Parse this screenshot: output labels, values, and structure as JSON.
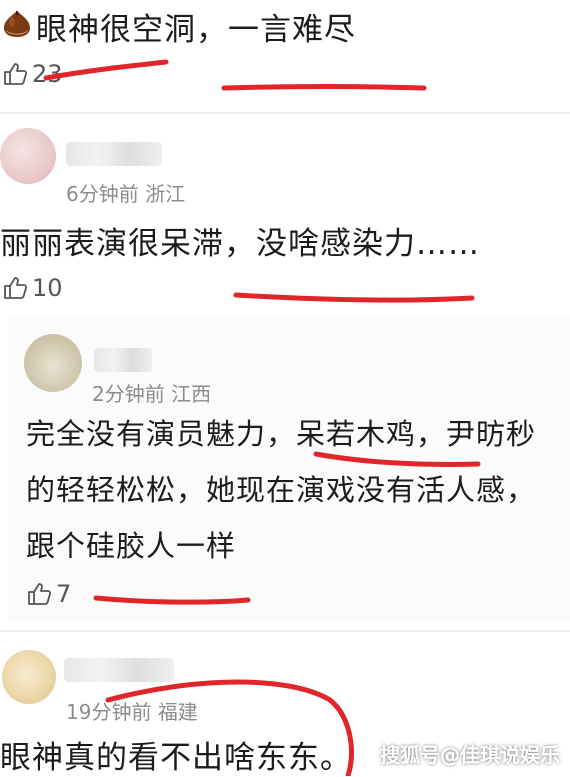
{
  "comments": [
    {
      "text": "眼神很空洞，一言难尽",
      "likes": "23"
    },
    {
      "meta": "6分钟前 浙江",
      "text": "丽丽表演很呆滞，没啥感染力……",
      "likes": "10"
    },
    {
      "meta": "2分钟前 江西",
      "lines": [
        "完全没有演员魅力，呆若木鸡，尹昉秒",
        "的轻轻松松，她现在演戏没有活人感，",
        "跟个硅胶人一样"
      ],
      "likes": "7"
    },
    {
      "meta": "19分钟前 福建",
      "text": "眼神真的看不出啥东东。"
    }
  ],
  "watermark": "搜狐号@佳琪说娱乐",
  "colors": {
    "annotation_red": "#e0262b",
    "meta_gray": "#8c8c8c"
  }
}
